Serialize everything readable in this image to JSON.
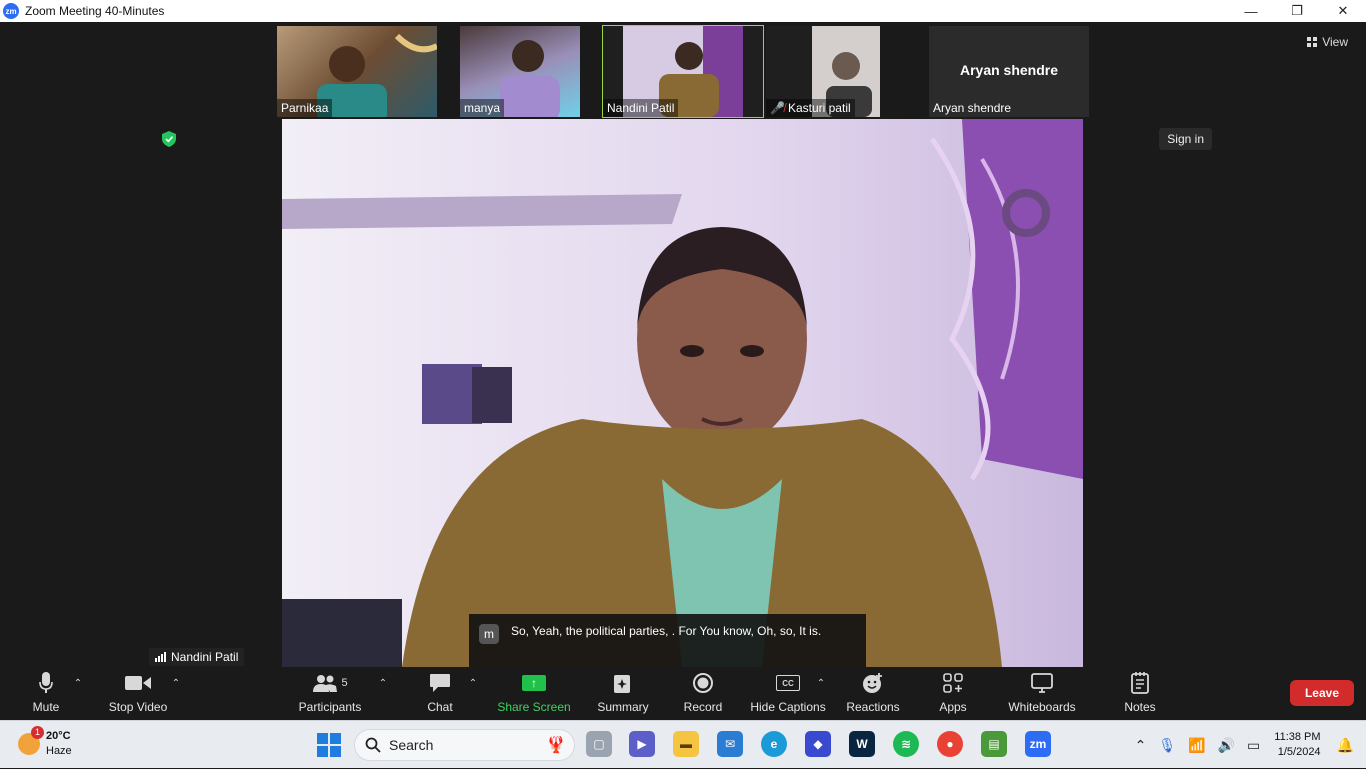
{
  "window": {
    "title": "Zoom Meeting 40-Minutes",
    "app_icon_text": "zm",
    "controls": {
      "minimize": "—",
      "restore": "❐",
      "close": "✕"
    }
  },
  "gallery": [
    {
      "name": "Parnikaa",
      "muted": false,
      "bg": "#8a6a4a"
    },
    {
      "name": "manya",
      "muted": false,
      "bg": "#7a6aa8"
    },
    {
      "name": "Nandini Patil",
      "muted": false,
      "bg": "#c9b8d8"
    },
    {
      "name": "Kasturi patil",
      "muted": true,
      "bg": "#c9c3bf"
    },
    {
      "name": "Aryan shendre",
      "muted": false,
      "bg": "#2b2b2b",
      "big_name": "Aryan shendre"
    }
  ],
  "top_right": {
    "view_label": "View",
    "sign_in_label": "Sign in"
  },
  "active_speaker": {
    "name": "Nandini Patil"
  },
  "caption": {
    "avatar_letter": "m",
    "text": "So, Yeah, the political parties, . For You know, Oh, so, It is."
  },
  "toolbar": {
    "mute": "Mute",
    "stop_video": "Stop Video",
    "participants": "Participants",
    "participants_count": "5",
    "chat": "Chat",
    "share_screen": "Share Screen",
    "summary": "Summary",
    "record": "Record",
    "hide_captions": "Hide Captions",
    "cc": "CC",
    "reactions": "Reactions",
    "apps": "Apps",
    "whiteboards": "Whiteboards",
    "notes": "Notes",
    "leave": "Leave"
  },
  "taskbar": {
    "weather_temp": "20°C",
    "weather_desc": "Haze",
    "weather_badge": "1",
    "search_label": "Search",
    "time": "11:38 PM",
    "date": "1/5/2024"
  },
  "colors": {
    "accent_green": "#21c04b",
    "leave_red": "#d12b2b",
    "active_tile_border": "#9bd640",
    "zoom_blue": "#2d6cf4"
  }
}
